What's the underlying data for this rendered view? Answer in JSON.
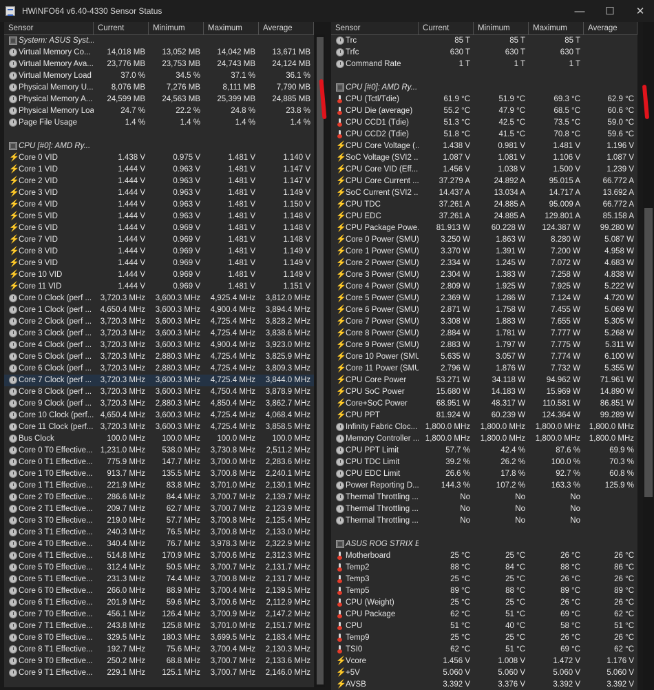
{
  "window": {
    "title": "HWiNFO64 v6.40-4330 Sensor Status",
    "minimize": "—",
    "maximize": "☐",
    "close": "✕"
  },
  "columns": [
    "Sensor",
    "Current",
    "Minimum",
    "Maximum",
    "Average"
  ],
  "left_rows": [
    {
      "t": "group",
      "name": "System: ASUS Syst..."
    },
    {
      "t": "clock",
      "name": "Virtual Memory Co...",
      "cur": "14,018 MB",
      "min": "13,052 MB",
      "max": "14,042 MB",
      "avg": "13,671 MB"
    },
    {
      "t": "clock",
      "name": "Virtual Memory Ava...",
      "cur": "23,776 MB",
      "min": "23,753 MB",
      "max": "24,743 MB",
      "avg": "24,124 MB"
    },
    {
      "t": "clock",
      "name": "Virtual Memory Load",
      "cur": "37.0 %",
      "min": "34.5 %",
      "max": "37.1 %",
      "avg": "36.1 %"
    },
    {
      "t": "clock",
      "name": "Physical Memory U...",
      "cur": "8,076 MB",
      "min": "7,276 MB",
      "max": "8,111 MB",
      "avg": "7,790 MB"
    },
    {
      "t": "clock",
      "name": "Physical Memory A...",
      "cur": "24,599 MB",
      "min": "24,563 MB",
      "max": "25,399 MB",
      "avg": "24,885 MB"
    },
    {
      "t": "clock",
      "name": "Physical Memory Load",
      "cur": "24.7 %",
      "min": "22.2 %",
      "max": "24.8 %",
      "avg": "23.8 %"
    },
    {
      "t": "clock",
      "name": "Page File Usage",
      "cur": "1.4 %",
      "min": "1.4 %",
      "max": "1.4 %",
      "avg": "1.4 %"
    },
    {
      "t": "blank"
    },
    {
      "t": "group",
      "name": "CPU [#0]: AMD Ry..."
    },
    {
      "t": "volt",
      "name": "Core 0 VID",
      "cur": "1.438 V",
      "min": "0.975 V",
      "max": "1.481 V",
      "avg": "1.140 V"
    },
    {
      "t": "volt",
      "name": "Core 1 VID",
      "cur": "1.444 V",
      "min": "0.963 V",
      "max": "1.481 V",
      "avg": "1.147 V"
    },
    {
      "t": "volt",
      "name": "Core 2 VID",
      "cur": "1.444 V",
      "min": "0.963 V",
      "max": "1.481 V",
      "avg": "1.147 V"
    },
    {
      "t": "volt",
      "name": "Core 3 VID",
      "cur": "1.444 V",
      "min": "0.963 V",
      "max": "1.481 V",
      "avg": "1.149 V"
    },
    {
      "t": "volt",
      "name": "Core 4 VID",
      "cur": "1.444 V",
      "min": "0.963 V",
      "max": "1.481 V",
      "avg": "1.150 V"
    },
    {
      "t": "volt",
      "name": "Core 5 VID",
      "cur": "1.444 V",
      "min": "0.963 V",
      "max": "1.481 V",
      "avg": "1.148 V"
    },
    {
      "t": "volt",
      "name": "Core 6 VID",
      "cur": "1.444 V",
      "min": "0.969 V",
      "max": "1.481 V",
      "avg": "1.148 V"
    },
    {
      "t": "volt",
      "name": "Core 7 VID",
      "cur": "1.444 V",
      "min": "0.969 V",
      "max": "1.481 V",
      "avg": "1.148 V"
    },
    {
      "t": "volt",
      "name": "Core 8 VID",
      "cur": "1.444 V",
      "min": "0.969 V",
      "max": "1.481 V",
      "avg": "1.149 V"
    },
    {
      "t": "volt",
      "name": "Core 9 VID",
      "cur": "1.444 V",
      "min": "0.969 V",
      "max": "1.481 V",
      "avg": "1.149 V"
    },
    {
      "t": "volt",
      "name": "Core 10 VID",
      "cur": "1.444 V",
      "min": "0.969 V",
      "max": "1.481 V",
      "avg": "1.149 V"
    },
    {
      "t": "volt",
      "name": "Core 11 VID",
      "cur": "1.444 V",
      "min": "0.969 V",
      "max": "1.481 V",
      "avg": "1.151 V"
    },
    {
      "t": "clock",
      "name": "Core 0 Clock (perf ...",
      "cur": "3,720.3 MHz",
      "min": "3,600.3 MHz",
      "max": "4,925.4 MHz",
      "avg": "3,812.0 MHz"
    },
    {
      "t": "clock",
      "name": "Core 1 Clock (perf ...",
      "cur": "4,650.4 MHz",
      "min": "3,600.3 MHz",
      "max": "4,900.4 MHz",
      "avg": "3,894.4 MHz"
    },
    {
      "t": "clock",
      "name": "Core 2 Clock (perf ...",
      "cur": "3,720.3 MHz",
      "min": "3,600.3 MHz",
      "max": "4,725.4 MHz",
      "avg": "3,828.2 MHz"
    },
    {
      "t": "clock",
      "name": "Core 3 Clock (perf ...",
      "cur": "3,720.3 MHz",
      "min": "3,600.3 MHz",
      "max": "4,725.4 MHz",
      "avg": "3,838.6 MHz"
    },
    {
      "t": "clock",
      "name": "Core 4 Clock (perf ...",
      "cur": "3,720.3 MHz",
      "min": "3,600.3 MHz",
      "max": "4,900.4 MHz",
      "avg": "3,923.0 MHz"
    },
    {
      "t": "clock",
      "name": "Core 5 Clock (perf ...",
      "cur": "3,720.3 MHz",
      "min": "2,880.3 MHz",
      "max": "4,725.4 MHz",
      "avg": "3,825.9 MHz"
    },
    {
      "t": "clock",
      "name": "Core 6 Clock (perf ...",
      "cur": "3,720.3 MHz",
      "min": "2,880.3 MHz",
      "max": "4,725.4 MHz",
      "avg": "3,809.3 MHz"
    },
    {
      "t": "clock",
      "name": "Core 7 Clock (perf ...",
      "cur": "3,720.3 MHz",
      "min": "3,600.3 MHz",
      "max": "4,725.4 MHz",
      "avg": "3,844.0 MHz",
      "hl": true
    },
    {
      "t": "clock",
      "name": "Core 8 Clock (perf ...",
      "cur": "3,720.3 MHz",
      "min": "3,600.3 MHz",
      "max": "4,750.4 MHz",
      "avg": "3,878.9 MHz"
    },
    {
      "t": "clock",
      "name": "Core 9 Clock (perf ...",
      "cur": "3,720.3 MHz",
      "min": "2,880.3 MHz",
      "max": "4,850.4 MHz",
      "avg": "3,862.7 MHz"
    },
    {
      "t": "clock",
      "name": "Core 10 Clock (perf...",
      "cur": "4,650.4 MHz",
      "min": "3,600.3 MHz",
      "max": "4,725.4 MHz",
      "avg": "4,068.4 MHz"
    },
    {
      "t": "clock",
      "name": "Core 11 Clock (perf...",
      "cur": "3,720.3 MHz",
      "min": "3,600.3 MHz",
      "max": "4,725.4 MHz",
      "avg": "3,858.5 MHz"
    },
    {
      "t": "clock",
      "name": "Bus Clock",
      "cur": "100.0 MHz",
      "min": "100.0 MHz",
      "max": "100.0 MHz",
      "avg": "100.0 MHz"
    },
    {
      "t": "clock",
      "name": "Core 0 T0 Effective...",
      "cur": "1,231.0 MHz",
      "min": "538.0 MHz",
      "max": "3,730.8 MHz",
      "avg": "2,511.2 MHz"
    },
    {
      "t": "clock",
      "name": "Core 0 T1 Effective...",
      "cur": "775.9 MHz",
      "min": "147.7 MHz",
      "max": "3,700.0 MHz",
      "avg": "2,283.6 MHz"
    },
    {
      "t": "clock",
      "name": "Core 1 T0 Effective...",
      "cur": "913.7 MHz",
      "min": "135.5 MHz",
      "max": "3,700.8 MHz",
      "avg": "2,240.1 MHz"
    },
    {
      "t": "clock",
      "name": "Core 1 T1 Effective...",
      "cur": "221.9 MHz",
      "min": "83.8 MHz",
      "max": "3,701.0 MHz",
      "avg": "2,130.1 MHz"
    },
    {
      "t": "clock",
      "name": "Core 2 T0 Effective...",
      "cur": "286.6 MHz",
      "min": "84.4 MHz",
      "max": "3,700.7 MHz",
      "avg": "2,139.7 MHz"
    },
    {
      "t": "clock",
      "name": "Core 2 T1 Effective...",
      "cur": "209.7 MHz",
      "min": "62.7 MHz",
      "max": "3,700.7 MHz",
      "avg": "2,123.9 MHz"
    },
    {
      "t": "clock",
      "name": "Core 3 T0 Effective...",
      "cur": "219.0 MHz",
      "min": "57.7 MHz",
      "max": "3,700.8 MHz",
      "avg": "2,125.4 MHz"
    },
    {
      "t": "clock",
      "name": "Core 3 T1 Effective...",
      "cur": "240.3 MHz",
      "min": "76.5 MHz",
      "max": "3,700.8 MHz",
      "avg": "2,133.0 MHz"
    },
    {
      "t": "clock",
      "name": "Core 4 T0 Effective...",
      "cur": "340.4 MHz",
      "min": "76.7 MHz",
      "max": "3,978.3 MHz",
      "avg": "2,322.9 MHz"
    },
    {
      "t": "clock",
      "name": "Core 4 T1 Effective...",
      "cur": "514.8 MHz",
      "min": "170.9 MHz",
      "max": "3,700.6 MHz",
      "avg": "2,312.3 MHz"
    },
    {
      "t": "clock",
      "name": "Core 5 T0 Effective...",
      "cur": "312.4 MHz",
      "min": "50.5 MHz",
      "max": "3,700.7 MHz",
      "avg": "2,131.7 MHz"
    },
    {
      "t": "clock",
      "name": "Core 5 T1 Effective...",
      "cur": "231.3 MHz",
      "min": "74.4 MHz",
      "max": "3,700.8 MHz",
      "avg": "2,131.7 MHz"
    },
    {
      "t": "clock",
      "name": "Core 6 T0 Effective...",
      "cur": "266.0 MHz",
      "min": "88.9 MHz",
      "max": "3,700.4 MHz",
      "avg": "2,139.5 MHz"
    },
    {
      "t": "clock",
      "name": "Core 6 T1 Effective...",
      "cur": "201.9 MHz",
      "min": "59.6 MHz",
      "max": "3,700.6 MHz",
      "avg": "2,112.9 MHz"
    },
    {
      "t": "clock",
      "name": "Core 7 T0 Effective...",
      "cur": "456.1 MHz",
      "min": "126.4 MHz",
      "max": "3,700.9 MHz",
      "avg": "2,147.2 MHz"
    },
    {
      "t": "clock",
      "name": "Core 7 T1 Effective...",
      "cur": "243.8 MHz",
      "min": "125.8 MHz",
      "max": "3,701.0 MHz",
      "avg": "2,151.7 MHz"
    },
    {
      "t": "clock",
      "name": "Core 8 T0 Effective...",
      "cur": "329.5 MHz",
      "min": "180.3 MHz",
      "max": "3,699.5 MHz",
      "avg": "2,183.4 MHz"
    },
    {
      "t": "clock",
      "name": "Core 8 T1 Effective...",
      "cur": "192.7 MHz",
      "min": "75.6 MHz",
      "max": "3,700.4 MHz",
      "avg": "2,130.3 MHz"
    },
    {
      "t": "clock",
      "name": "Core 9 T0 Effective...",
      "cur": "250.2 MHz",
      "min": "68.8 MHz",
      "max": "3,700.7 MHz",
      "avg": "2,133.6 MHz"
    },
    {
      "t": "clock",
      "name": "Core 9 T1 Effective...",
      "cur": "229.1 MHz",
      "min": "125.1 MHz",
      "max": "3,700.7 MHz",
      "avg": "2,146.0 MHz"
    }
  ],
  "right_rows": [
    {
      "t": "clock",
      "name": "Trc",
      "cur": "85 T",
      "min": "85 T",
      "max": "85 T",
      "avg": ""
    },
    {
      "t": "clock",
      "name": "Trfc",
      "cur": "630 T",
      "min": "630 T",
      "max": "630 T",
      "avg": ""
    },
    {
      "t": "clock",
      "name": "Command Rate",
      "cur": "1 T",
      "min": "1 T",
      "max": "1 T",
      "avg": ""
    },
    {
      "t": "blank"
    },
    {
      "t": "group",
      "name": "CPU [#0]: AMD Ry..."
    },
    {
      "t": "temp",
      "name": "CPU (Tctl/Tdie)",
      "cur": "61.9 °C",
      "min": "51.9 °C",
      "max": "69.3 °C",
      "avg": "62.9 °C"
    },
    {
      "t": "temp",
      "name": "CPU Die (average)",
      "cur": "55.2 °C",
      "min": "47.9 °C",
      "max": "68.5 °C",
      "avg": "60.6 °C"
    },
    {
      "t": "temp",
      "name": "CPU CCD1 (Tdie)",
      "cur": "51.3 °C",
      "min": "42.5 °C",
      "max": "73.5 °C",
      "avg": "59.0 °C"
    },
    {
      "t": "temp",
      "name": "CPU CCD2 (Tdie)",
      "cur": "51.8 °C",
      "min": "41.5 °C",
      "max": "70.8 °C",
      "avg": "59.6 °C"
    },
    {
      "t": "volt",
      "name": "CPU Core Voltage (...",
      "cur": "1.438 V",
      "min": "0.981 V",
      "max": "1.481 V",
      "avg": "1.196 V"
    },
    {
      "t": "volt",
      "name": "SoC Voltage (SVI2 ...",
      "cur": "1.087 V",
      "min": "1.081 V",
      "max": "1.106 V",
      "avg": "1.087 V"
    },
    {
      "t": "volt",
      "name": "CPU Core VID (Eff...",
      "cur": "1.456 V",
      "min": "1.038 V",
      "max": "1.500 V",
      "avg": "1.239 V"
    },
    {
      "t": "volt",
      "name": "CPU Core Current ...",
      "cur": "37.279 A",
      "min": "24.892 A",
      "max": "95.015 A",
      "avg": "66.772 A"
    },
    {
      "t": "volt",
      "name": "SoC Current (SVI2 ...",
      "cur": "14.437 A",
      "min": "13.034 A",
      "max": "14.717 A",
      "avg": "13.692 A"
    },
    {
      "t": "volt",
      "name": "CPU TDC",
      "cur": "37.261 A",
      "min": "24.885 A",
      "max": "95.009 A",
      "avg": "66.772 A"
    },
    {
      "t": "volt",
      "name": "CPU EDC",
      "cur": "37.261 A",
      "min": "24.885 A",
      "max": "129.801 A",
      "avg": "85.158 A"
    },
    {
      "t": "volt",
      "name": "CPU Package Powe...",
      "cur": "81.913 W",
      "min": "60.228 W",
      "max": "124.387 W",
      "avg": "99.280 W"
    },
    {
      "t": "volt",
      "name": "Core 0 Power (SMU)",
      "cur": "3.250 W",
      "min": "1.863 W",
      "max": "8.280 W",
      "avg": "5.087 W"
    },
    {
      "t": "volt",
      "name": "Core 1 Power (SMU)",
      "cur": "3.370 W",
      "min": "1.391 W",
      "max": "7.200 W",
      "avg": "4.958 W"
    },
    {
      "t": "volt",
      "name": "Core 2 Power (SMU)",
      "cur": "2.334 W",
      "min": "1.245 W",
      "max": "7.072 W",
      "avg": "4.683 W"
    },
    {
      "t": "volt",
      "name": "Core 3 Power (SMU)",
      "cur": "2.304 W",
      "min": "1.383 W",
      "max": "7.258 W",
      "avg": "4.838 W"
    },
    {
      "t": "volt",
      "name": "Core 4 Power (SMU)",
      "cur": "2.809 W",
      "min": "1.925 W",
      "max": "7.925 W",
      "avg": "5.222 W"
    },
    {
      "t": "volt",
      "name": "Core 5 Power (SMU)",
      "cur": "2.369 W",
      "min": "1.286 W",
      "max": "7.124 W",
      "avg": "4.720 W"
    },
    {
      "t": "volt",
      "name": "Core 6 Power (SMU)",
      "cur": "2.871 W",
      "min": "1.758 W",
      "max": "7.455 W",
      "avg": "5.069 W"
    },
    {
      "t": "volt",
      "name": "Core 7 Power (SMU)",
      "cur": "3.308 W",
      "min": "1.883 W",
      "max": "7.655 W",
      "avg": "5.305 W"
    },
    {
      "t": "volt",
      "name": "Core 8 Power (SMU)",
      "cur": "2.884 W",
      "min": "1.781 W",
      "max": "7.777 W",
      "avg": "5.268 W"
    },
    {
      "t": "volt",
      "name": "Core 9 Power (SMU)",
      "cur": "2.883 W",
      "min": "1.797 W",
      "max": "7.775 W",
      "avg": "5.311 W"
    },
    {
      "t": "volt",
      "name": "Core 10 Power (SMU)",
      "cur": "5.635 W",
      "min": "3.057 W",
      "max": "7.774 W",
      "avg": "6.100 W"
    },
    {
      "t": "volt",
      "name": "Core 11 Power (SMU)",
      "cur": "2.796 W",
      "min": "1.876 W",
      "max": "7.732 W",
      "avg": "5.355 W"
    },
    {
      "t": "volt",
      "name": "CPU Core Power",
      "cur": "53.271 W",
      "min": "34.118 W",
      "max": "94.962 W",
      "avg": "71.961 W"
    },
    {
      "t": "volt",
      "name": "CPU SoC Power",
      "cur": "15.680 W",
      "min": "14.183 W",
      "max": "15.969 W",
      "avg": "14.890 W"
    },
    {
      "t": "volt",
      "name": "Core+SoC Power",
      "cur": "68.951 W",
      "min": "48.317 W",
      "max": "110.581 W",
      "avg": "86.851 W"
    },
    {
      "t": "volt",
      "name": "CPU PPT",
      "cur": "81.924 W",
      "min": "60.239 W",
      "max": "124.364 W",
      "avg": "99.289 W"
    },
    {
      "t": "clock",
      "name": "Infinity Fabric Cloc...",
      "cur": "1,800.0 MHz",
      "min": "1,800.0 MHz",
      "max": "1,800.0 MHz",
      "avg": "1,800.0 MHz"
    },
    {
      "t": "clock",
      "name": "Memory Controller ...",
      "cur": "1,800.0 MHz",
      "min": "1,800.0 MHz",
      "max": "1,800.0 MHz",
      "avg": "1,800.0 MHz"
    },
    {
      "t": "clock",
      "name": "CPU PPT Limit",
      "cur": "57.7 %",
      "min": "42.4 %",
      "max": "87.6 %",
      "avg": "69.9 %"
    },
    {
      "t": "clock",
      "name": "CPU TDC Limit",
      "cur": "39.2 %",
      "min": "26.2 %",
      "max": "100.0 %",
      "avg": "70.3 %"
    },
    {
      "t": "clock",
      "name": "CPU EDC Limit",
      "cur": "26.6 %",
      "min": "17.8 %",
      "max": "92.7 %",
      "avg": "60.8 %"
    },
    {
      "t": "clock",
      "name": "Power Reporting D...",
      "cur": "144.3 %",
      "min": "107.2 %",
      "max": "163.3 %",
      "avg": "125.9 %"
    },
    {
      "t": "clock",
      "name": "Thermal Throttling ...",
      "cur": "No",
      "min": "No",
      "max": "No",
      "avg": ""
    },
    {
      "t": "clock",
      "name": "Thermal Throttling ...",
      "cur": "No",
      "min": "No",
      "max": "No",
      "avg": ""
    },
    {
      "t": "clock",
      "name": "Thermal Throttling ...",
      "cur": "No",
      "min": "No",
      "max": "No",
      "avg": ""
    },
    {
      "t": "blank"
    },
    {
      "t": "group",
      "name": "ASUS ROG STRIX B..."
    },
    {
      "t": "temp",
      "name": "Motherboard",
      "cur": "25 °C",
      "min": "25 °C",
      "max": "26 °C",
      "avg": "26 °C"
    },
    {
      "t": "temp",
      "name": "Temp2",
      "cur": "88 °C",
      "min": "84 °C",
      "max": "88 °C",
      "avg": "86 °C"
    },
    {
      "t": "temp",
      "name": "Temp3",
      "cur": "25 °C",
      "min": "25 °C",
      "max": "26 °C",
      "avg": "26 °C"
    },
    {
      "t": "temp",
      "name": "Temp5",
      "cur": "89 °C",
      "min": "88 °C",
      "max": "89 °C",
      "avg": "89 °C"
    },
    {
      "t": "temp",
      "name": "CPU (Weight)",
      "cur": "25 °C",
      "min": "25 °C",
      "max": "26 °C",
      "avg": "26 °C"
    },
    {
      "t": "temp",
      "name": "CPU Package",
      "cur": "62 °C",
      "min": "51 °C",
      "max": "69 °C",
      "avg": "62 °C"
    },
    {
      "t": "temp",
      "name": "CPU",
      "cur": "51 °C",
      "min": "40 °C",
      "max": "58 °C",
      "avg": "51 °C"
    },
    {
      "t": "temp",
      "name": "Temp9",
      "cur": "25 °C",
      "min": "25 °C",
      "max": "26 °C",
      "avg": "26 °C"
    },
    {
      "t": "temp",
      "name": "TSI0",
      "cur": "62 °C",
      "min": "51 °C",
      "max": "69 °C",
      "avg": "62 °C"
    },
    {
      "t": "volt",
      "name": "Vcore",
      "cur": "1.456 V",
      "min": "1.008 V",
      "max": "1.472 V",
      "avg": "1.176 V"
    },
    {
      "t": "volt",
      "name": "+5V",
      "cur": "5.060 V",
      "min": "5.060 V",
      "max": "5.060 V",
      "avg": "5.060 V"
    },
    {
      "t": "volt",
      "name": "AVSB",
      "cur": "3.392 V",
      "min": "3.376 V",
      "max": "3.392 V",
      "avg": "3.392 V"
    }
  ]
}
